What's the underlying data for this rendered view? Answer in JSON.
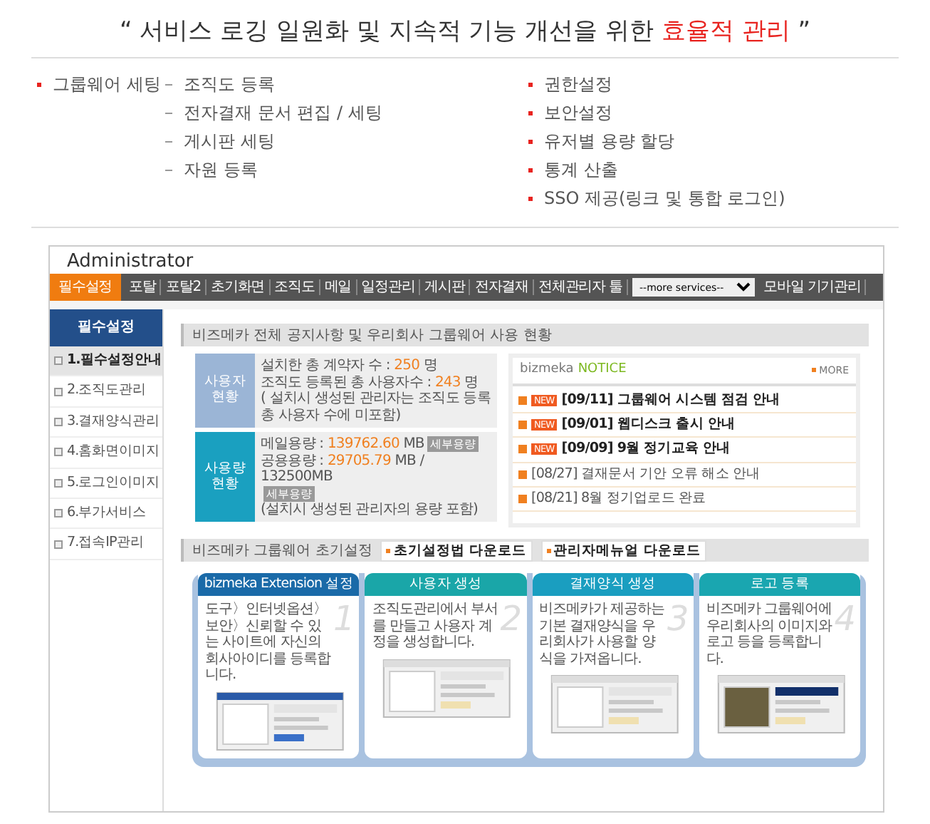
{
  "headline": [
    {
      "text": "“ 서비스 로깅 일원화 및 지속적 기능 개선을 위한 ",
      "accent": false
    },
    {
      "text": "효율적 관리",
      "accent": true
    },
    {
      "text": " ”",
      "accent": false
    }
  ],
  "features": {
    "group": "그룹웨어 세팅",
    "group_items": [
      "조직도 등록",
      "전자결재 문서 편집 / 세팅",
      "게시판 세팅",
      "자원 등록"
    ],
    "items": [
      "권한설정",
      "보안설정",
      "유저별 용량 할당",
      "통계 산출",
      "SSO 제공(링크 및 통합 로그인)"
    ]
  },
  "admin": {
    "title": "Administrator",
    "nav": [
      {
        "label": "필수설정",
        "selected": true
      },
      {
        "label": "포탈",
        "selected": false
      },
      {
        "label": "포탈2",
        "selected": false
      },
      {
        "label": "초기화면",
        "selected": false
      },
      {
        "label": "조직도",
        "selected": false
      },
      {
        "label": "메일",
        "selected": false
      },
      {
        "label": "일정관리",
        "selected": false
      },
      {
        "label": "게시판",
        "selected": false
      },
      {
        "label": "전자결재",
        "selected": false
      },
      {
        "label": "전체관리자 툴",
        "selected": false
      }
    ],
    "services_select": "--more services--",
    "mobile": "모바일 기기관리",
    "sidebar": {
      "title": "필수설정",
      "items": [
        {
          "label": "1.필수설정안내",
          "selected": true
        },
        {
          "label": "2.조직도관리",
          "selected": false
        },
        {
          "label": "3.결재양식관리",
          "selected": false
        },
        {
          "label": "4.홈화면이미지",
          "selected": false
        },
        {
          "label": "5.로그인이미지",
          "selected": false
        },
        {
          "label": "6.부가서비스",
          "selected": false
        },
        {
          "label": "7.접속IP관리",
          "selected": false
        }
      ]
    },
    "status_heading": "비즈메카 전체 공지사항 및 우리회사 그룹웨어 사용 현황",
    "stats": [
      {
        "tile": "사용자현황",
        "color": "#9bb5d6",
        "lines": [
          {
            "label": "설치한 총 계약자 수 : ",
            "value": "250",
            "unit": " 명"
          },
          {
            "label": "조직도 등록된 총 사용자수 : ",
            "value": "243",
            "unit": " 명"
          },
          {
            "label": "( 설치시 생성된 관리자는 조직도 등록 총 사용자 수에 미포함)"
          }
        ]
      },
      {
        "tile": "사용량현황",
        "color": "#1aa0c0",
        "lines": [
          {
            "label": "메일용량 : ",
            "value": "139762.60",
            "unit": " MB",
            "button": "세부용량"
          },
          {
            "label": "공용용량 : ",
            "value": "29705.79",
            "unit": " MB / 132500MB",
            "button": "세부용량"
          },
          {
            "label": "(설치시 생성된 관리자의 용량 포함)"
          }
        ]
      }
    ],
    "notice": {
      "brand": "bizmeka",
      "title": "NOTICE",
      "more": "MORE",
      "items": [
        {
          "date": "[09/11]",
          "title": "그룹웨어 시스템 점검 안내",
          "badge": "NEW"
        },
        {
          "date": "[09/01]",
          "title": "웹디스크 출시 안내",
          "badge": "NEW"
        },
        {
          "date": "[09/09]",
          "title": "9월 정기교육 안내",
          "badge": "NEW"
        },
        {
          "date": "[08/27]",
          "title": "결재문서 기안 오류 해소 안내"
        },
        {
          "date": "[08/21]",
          "title": "8월 정기업로드 완료"
        }
      ]
    },
    "setup_heading": "비즈메카 그룹웨어 초기설정",
    "downloads": [
      "초기설정법 다운로드",
      "관리자메뉴얼 다운로드"
    ],
    "steps": [
      {
        "title": "bizmeka Extension 설정",
        "color": "#1a6aa8",
        "number": "1",
        "text": "도구〉인터넷옵션〉보안〉신뢰할 수 있는 사이트에 자신의 회사아이디를 등록합니다."
      },
      {
        "title": "사용자 생성",
        "color": "#1aa6a8",
        "number": "2",
        "text": "조직도관리에서 부서를 만들고 사용자 계정을 생성합니다."
      },
      {
        "title": "결재양식 생성",
        "color": "#1a9ec0",
        "number": "3",
        "text": "비즈메카가 제공하는 기본 결재양식을 우리회사가 사용할 양식을 가져옵니다."
      },
      {
        "title": "로고 등록",
        "color": "#1aa6b0",
        "number": "4",
        "text": "비즈메카 그룹웨어에 우리회사의 이미지와 로고 등을 등록합니다."
      }
    ]
  }
}
